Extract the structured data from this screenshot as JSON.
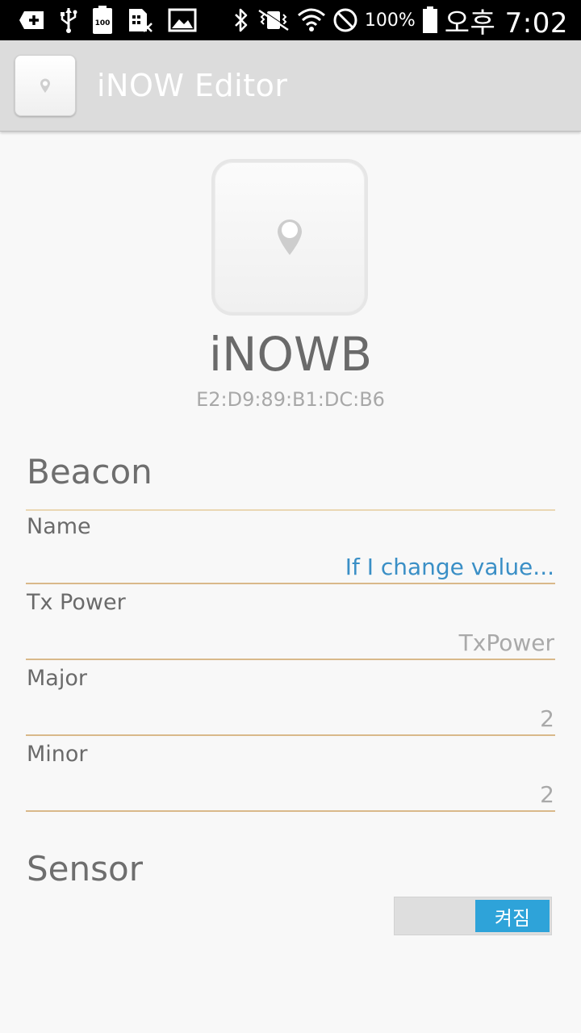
{
  "status_bar": {
    "icons_left": [
      "add-box-icon",
      "usb-icon",
      "battery-100-icon",
      "sim-off-icon",
      "image-icon"
    ],
    "icons_right": [
      "bluetooth-icon",
      "vibrate-icon",
      "wifi-icon",
      "do-not-disturb-icon",
      "battery-icon"
    ],
    "battery": "100%",
    "time": "오후 7:02"
  },
  "action_bar": {
    "title": "iNOW Editor",
    "icon": "location-pin-icon"
  },
  "device": {
    "name": "iNOWB",
    "mac": "E2:D9:89:B1:DC:B6",
    "icon": "location-pin-icon"
  },
  "beacon": {
    "title": "Beacon",
    "fields": [
      {
        "label": "Name",
        "value": "If I change value..."
      },
      {
        "label": "Tx Power",
        "value": "TxPower"
      },
      {
        "label": "Major",
        "value": "2"
      },
      {
        "label": "Minor",
        "value": "2"
      }
    ]
  },
  "sensor": {
    "title": "Sensor",
    "toggle_label": "켜짐"
  },
  "colors": {
    "accent": "#2ea3d9",
    "edited_text": "#3a8fc6",
    "rule": "#d9b98a"
  }
}
